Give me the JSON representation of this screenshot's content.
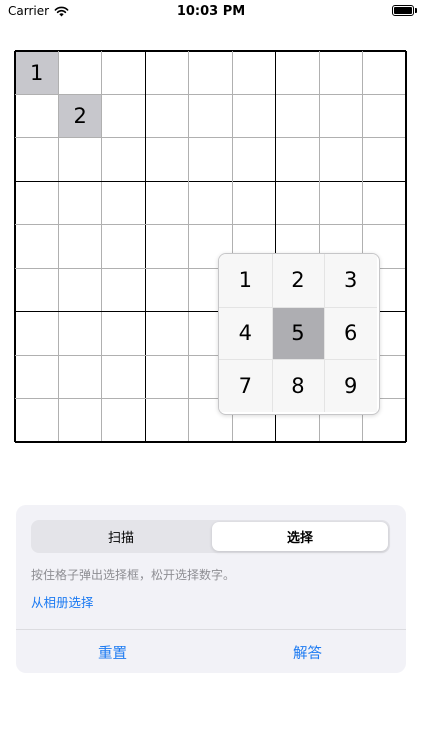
{
  "status_bar": {
    "carrier": "Carrier",
    "time": "10:03 PM",
    "icons": [
      "wifi-icon",
      "battery-icon"
    ]
  },
  "grid": {
    "size": 9,
    "filled_cells": [
      {
        "row": 0,
        "col": 0,
        "value": "1"
      },
      {
        "row": 1,
        "col": 1,
        "value": "2"
      }
    ]
  },
  "picker": {
    "numbers": [
      "1",
      "2",
      "3",
      "4",
      "5",
      "6",
      "7",
      "8",
      "9"
    ],
    "selected": "5"
  },
  "panel": {
    "segments": [
      "扫描",
      "选择"
    ],
    "active_segment": "选择",
    "hint": "按住格子弹出选择框，松开选择数字。",
    "album_link": "从相册选择",
    "reset_label": "重置",
    "solve_label": "解答"
  },
  "colors": {
    "accent": "#1d7bf2",
    "filled_cell": "#c7c7cc",
    "selected_number": "#aeaeb2",
    "panel_background": "#f2f2f7"
  }
}
